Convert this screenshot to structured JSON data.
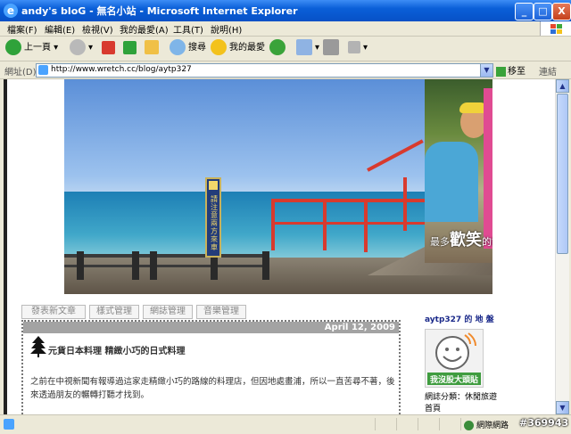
{
  "window": {
    "title": "andy's bloG - 無名小站 - Microsoft Internet Explorer",
    "ie_icon": "e",
    "controls": {
      "minimize": "_",
      "maximize": "□",
      "close": "X"
    }
  },
  "menu": [
    "檔案(F)",
    "編輯(E)",
    "檢視(V)",
    "我的最愛(A)",
    "工具(T)",
    "說明(H)"
  ],
  "toolbar": {
    "back": "上一頁",
    "search": "搜尋",
    "favorites": "我的最愛"
  },
  "address": {
    "label": "網址(D)",
    "url": "http://www.wretch.cc/blog/aytp327",
    "go": "移至",
    "links": "連結"
  },
  "banner": {
    "sign_text": "請注意兩方來車",
    "tagline_pre": "最多",
    "tagline_big": "歡笑",
    "tagline_post": "的節目"
  },
  "blog": {
    "tabs": [
      "發表新文章",
      "樣式管理",
      "網誌管理",
      "音樂管理"
    ],
    "post_date": "April 12, 2009",
    "post_title": "元貨日本料理 精緻小巧的日式料理",
    "post_body": "之前在中視新聞有報導過這家走精緻小巧的路線的料理店，但因地處畫浦，所以一直苦尋不著，後來透過朋友的輾轉打聽才找到。",
    "sidebar_title": "aytp327 的 地 盤",
    "avatar_text": "我沒股大頭貼",
    "category": "網誌分類：休閒旅遊",
    "home": "首頁"
  },
  "status": {
    "zone": "網際網路",
    "watermark": "#369943"
  },
  "colors": {
    "titlebar": "#0a5fd8",
    "chrome": "#ece9d8",
    "date_bar": "#a3a3a3",
    "sidebar_title": "#1b2a8a"
  }
}
